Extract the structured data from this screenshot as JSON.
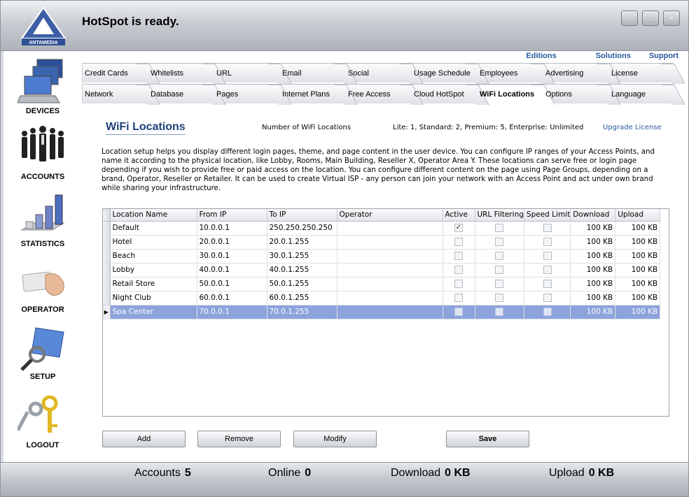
{
  "window": {
    "title": "HotSpot is ready.",
    "logo_text": "ANTAMEDIA",
    "controls": [
      "minimize-icon",
      "restore-icon",
      "close-icon"
    ]
  },
  "sidebar": {
    "items": [
      {
        "label": "DEVICES",
        "icon": "devices-icon"
      },
      {
        "label": "ACCOUNTS",
        "icon": "accounts-icon"
      },
      {
        "label": "STATISTICS",
        "icon": "statistics-icon"
      },
      {
        "label": "OPERATOR",
        "icon": "operator-icon"
      },
      {
        "label": "SETUP",
        "icon": "setup-icon"
      },
      {
        "label": "LOGOUT",
        "icon": "keys-icon"
      }
    ]
  },
  "toplinks": [
    "Editions",
    "Solutions",
    "Support"
  ],
  "tabs": {
    "row1": [
      "Credit Cards",
      "Whitelists",
      "URL",
      "Email",
      "Social",
      "Usage Schedule",
      "Employees",
      "Advertising",
      "License"
    ],
    "row2": [
      "Network",
      "Database",
      "Pages",
      "Internet Plans",
      "Free Access",
      "Cloud HotSpot",
      "WiFi Locations",
      "Options",
      "Language"
    ],
    "active": "WiFi Locations"
  },
  "content": {
    "title": "WiFi Locations",
    "count_label": "Number of WiFi Locations",
    "count_value": "Lite: 1, Standard: 2, Premium: 5, Enterprise: Unlimited",
    "upgrade_link": "Upgrade License",
    "description": "Location setup helps you display different login pages, theme, and page content in the user device. You can configure IP ranges of your Access Points, and name it according to the physical location, like Lobby, Rooms, Main Building, Reseller X, Operator Area Y. These locations can serve free or login page depending if you wish to provide free or paid access on the location. You can configure different content on the page using Page Groups, depending on a brand, Operator, Reseller or Retailer. It can be used to create Virtual ISP - any person can join your network with an Access Point and act under own brand while sharing your infrastructure."
  },
  "grid": {
    "columns": [
      "Location Name",
      "From IP",
      "To IP",
      "Operator",
      "Active",
      "URL Filtering",
      "Speed Limit",
      "Download",
      "Upload"
    ],
    "rows": [
      {
        "name": "Default",
        "from": "10.0.0.1",
        "to": "250.250.250.250",
        "operator": "",
        "active": true,
        "url_filtering": false,
        "speed_limit": false,
        "download": "100 KB",
        "upload": "100 KB"
      },
      {
        "name": "Hotel",
        "from": "20.0.0.1",
        "to": "20.0.1.255",
        "operator": "",
        "active": false,
        "url_filtering": false,
        "speed_limit": false,
        "download": "100 KB",
        "upload": "100 KB"
      },
      {
        "name": "Beach",
        "from": "30.0.0.1",
        "to": "30.0.1.255",
        "operator": "",
        "active": false,
        "url_filtering": false,
        "speed_limit": false,
        "download": "100 KB",
        "upload": "100 KB"
      },
      {
        "name": "Lobby",
        "from": "40.0.0.1",
        "to": "40.0.1.255",
        "operator": "",
        "active": false,
        "url_filtering": false,
        "speed_limit": false,
        "download": "100 KB",
        "upload": "100 KB"
      },
      {
        "name": "Retail Store",
        "from": "50.0.0.1",
        "to": "50.0.1.255",
        "operator": "",
        "active": false,
        "url_filtering": false,
        "speed_limit": false,
        "download": "100 KB",
        "upload": "100 KB"
      },
      {
        "name": "Night Club",
        "from": "60.0.0.1",
        "to": "60.0.1.255",
        "operator": "",
        "active": false,
        "url_filtering": false,
        "speed_limit": false,
        "download": "100 KB",
        "upload": "100 KB"
      },
      {
        "name": "Spa Center",
        "from": "70.0.0.1",
        "to": "70.0.1.255",
        "operator": "",
        "active": false,
        "url_filtering": false,
        "speed_limit": false,
        "download": "100 KB",
        "upload": "100 KB",
        "selected": true
      }
    ]
  },
  "buttons": {
    "add": "Add",
    "remove": "Remove",
    "modify": "Modify",
    "save": "Save"
  },
  "status": {
    "accounts_label": "Accounts",
    "accounts_value": "5",
    "online_label": "Online",
    "online_value": "0",
    "download_label": "Download",
    "download_value": "0 KB",
    "upload_label": "Upload",
    "upload_value": "0 KB"
  },
  "colors": {
    "accent": "#1e3f7a",
    "link": "#2a58a0",
    "selection": "#8da3dc"
  }
}
